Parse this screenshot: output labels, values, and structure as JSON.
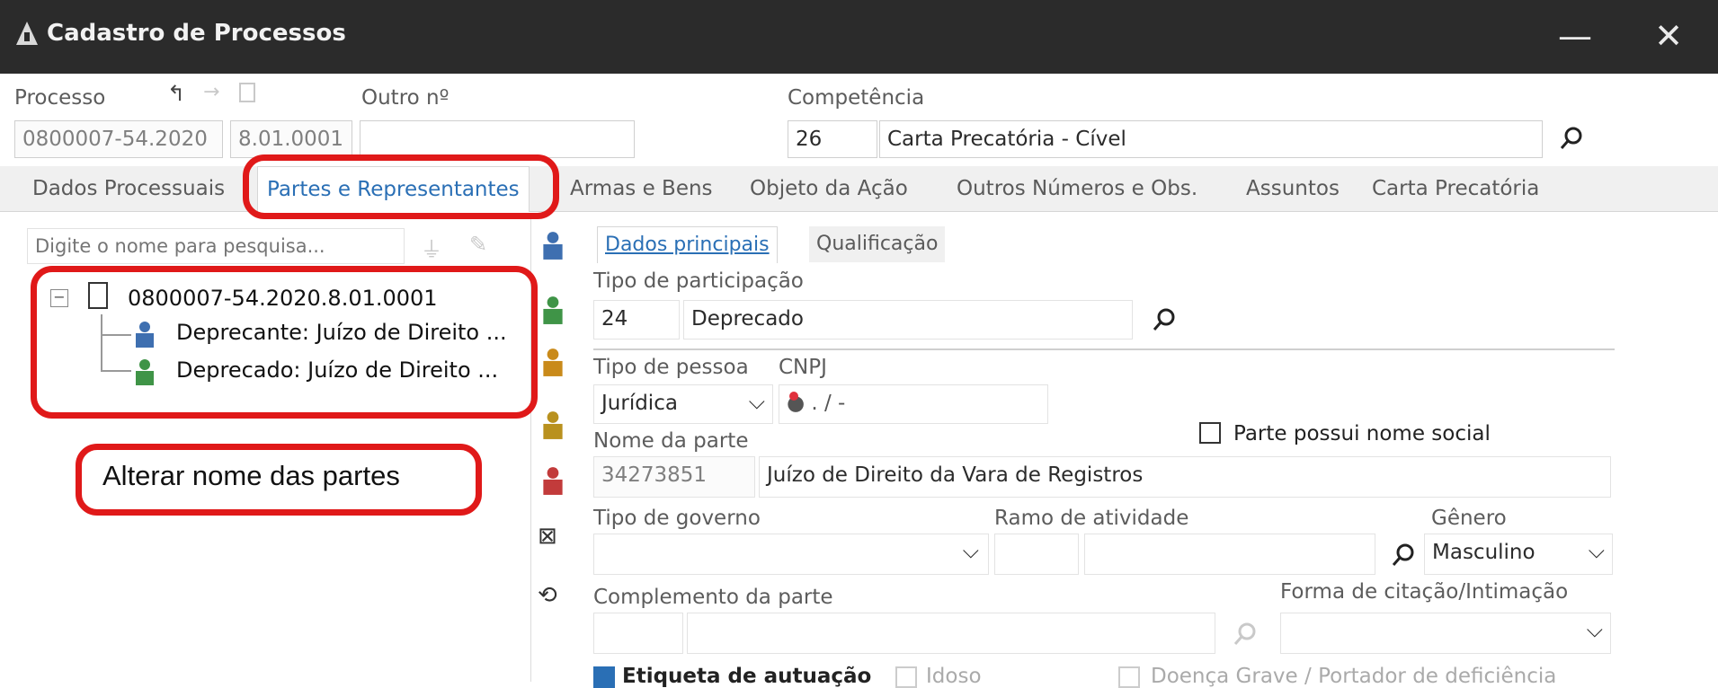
{
  "window": {
    "title": "Cadastro de Processos",
    "minimize": "—",
    "close": "✕"
  },
  "header": {
    "processo_label": "Processo",
    "processo_number": "0800007-54.2020",
    "processo_suffix": "8.01.0001",
    "outro_label": "Outro nº",
    "outro_value": "",
    "competencia_label": "Competência",
    "competencia_code": "26",
    "competencia_name": "Carta Precatória - Cível"
  },
  "tabs": [
    {
      "label": "Dados Processuais"
    },
    {
      "label": "Partes e Representantes",
      "active": true
    },
    {
      "label": "Armas e Bens"
    },
    {
      "label": "Objeto da Ação"
    },
    {
      "label": "Outros Números e Obs."
    },
    {
      "label": "Assuntos"
    },
    {
      "label": "Carta Precatória"
    }
  ],
  "left_panel": {
    "search_placeholder": "Digite o nome para pesquisa...",
    "tree": {
      "root": "0800007-54.2020.8.01.0001",
      "children": [
        {
          "label": "Deprecante: Juízo de Direito ..."
        },
        {
          "label": "Deprecado: Juízo de Direito ..."
        }
      ]
    },
    "annotation": "Alterar nome das partes"
  },
  "subtabs": [
    {
      "label": "Dados principais",
      "active": true
    },
    {
      "label": "Qualificação"
    }
  ],
  "form": {
    "tipo_participacao_label": "Tipo de participação",
    "tipo_participacao_code": "24",
    "tipo_participacao_name": "Deprecado",
    "tipo_pessoa_label": "Tipo de pessoa",
    "tipo_pessoa_value": "Jurídica",
    "cnpj_label": "CNPJ",
    "cnpj_mask": "●  .  /  -",
    "nome_social_label": "Parte possui nome social",
    "nome_parte_label": "Nome da parte",
    "nome_parte_code": "34273851",
    "nome_parte_value": "Juízo de Direito da Vara de Registros",
    "tipo_governo_label": "Tipo de governo",
    "ramo_atividade_label": "Ramo de atividade",
    "genero_label": "Gênero",
    "genero_value": "Masculino",
    "complemento_label": "Complemento da parte",
    "forma_citacao_label": "Forma de citação/Intimação",
    "etiqueta_label": "Etiqueta de autuação",
    "idoso_label": "Idoso",
    "doenca_label": "Doença Grave / Portador de deficiência"
  },
  "colors": {
    "highlight": "#e01919",
    "accent": "#2a6fb5",
    "titlebar": "#2b2b2b"
  }
}
